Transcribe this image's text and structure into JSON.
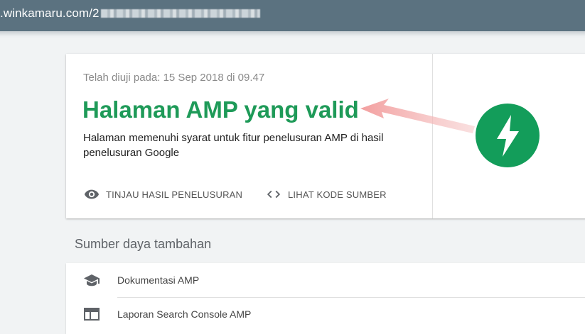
{
  "browser": {
    "url_visible": ".winkamaru.com/2",
    "url_redacted": true
  },
  "result": {
    "tested_on": "Telah diuji pada: 15 Sep 2018 di 09.47",
    "heading": "Halaman AMP yang valid",
    "description": "Halaman memenuhi syarat untuk fitur penelusuran AMP di hasil penelusuran Google",
    "actions": [
      {
        "label": "TINJAU HASIL PENELUSURAN",
        "icon": "eye-icon"
      },
      {
        "label": "LIHAT KODE SUMBER",
        "icon": "code-icon"
      }
    ],
    "badge_icon": "amp-lightning-icon"
  },
  "resources": {
    "title": "Sumber daya tambahan",
    "items": [
      {
        "label": "Dokumentasi AMP",
        "icon": "school-cap-icon"
      },
      {
        "label": "Laporan Search Console AMP",
        "icon": "browser-window-icon"
      }
    ]
  },
  "colors": {
    "topbar": "#5b7280",
    "valid_green": "#1e9a58",
    "amp_badge": "#139d5a",
    "annotation_arrow": "#f5a3a3"
  }
}
